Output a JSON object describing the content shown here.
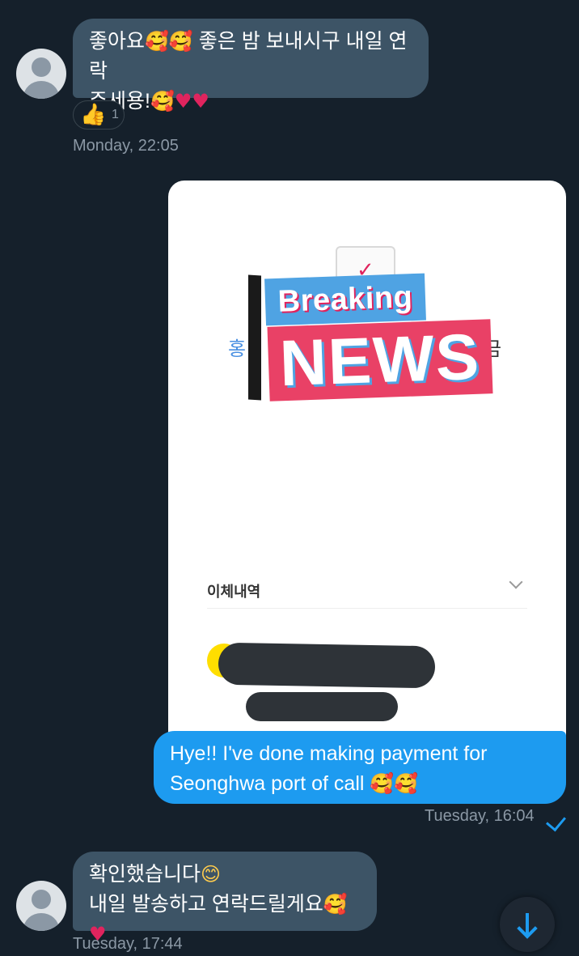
{
  "messages": [
    {
      "line1_text": "좋아요",
      "line1_rest": " 좋은 밤 보내시구 내일 연락",
      "line2_text": "주세용!",
      "timestamp": "Monday, 22:05",
      "reaction": {
        "icon": "thumbs-up-icon",
        "glyph": "👍",
        "count": "1"
      }
    },
    {
      "image": {
        "ko_left": "홍",
        "ko_right": "금",
        "breaking": "Breaking",
        "news": "NEWS",
        "section_label": "이체내역"
      },
      "line1_text": "Hye!! I've done making payment for",
      "line2_text": "Seonghwa port of call",
      "timestamp": "Tuesday, 16:04"
    },
    {
      "line1_text": "확인했습니다",
      "line2_text": "내일 발송하고 연락드릴게요",
      "timestamp": "Tuesday, 17:44"
    }
  ],
  "emoji": {
    "smiling_hearts": "🥰",
    "heart": "♥",
    "smile": "😊"
  },
  "colors": {
    "background": "#15202b",
    "incoming_bubble": "#3d5466",
    "outgoing_bubble": "#1d9bf0",
    "accent": "#1d9bf0",
    "timestamp": "#8b98a5"
  }
}
